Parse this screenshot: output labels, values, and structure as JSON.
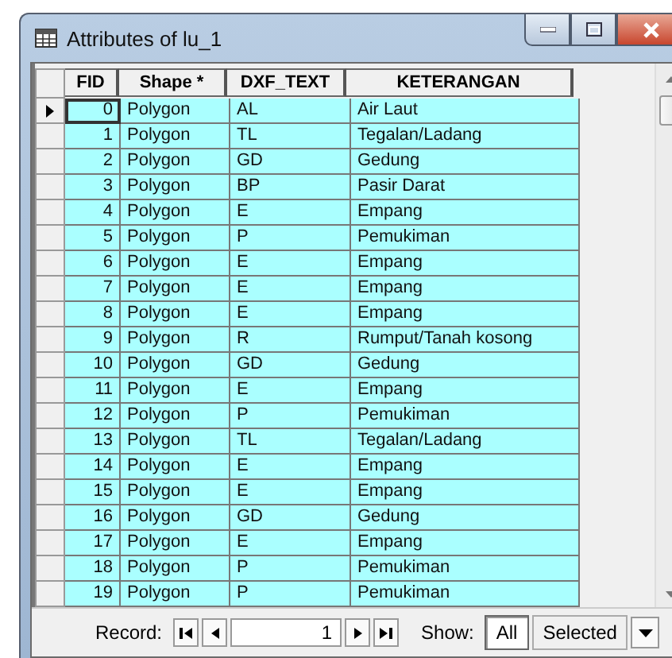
{
  "window": {
    "title": "Attributes of lu_1"
  },
  "table": {
    "columns": [
      "FID",
      "Shape *",
      "DXF_TEXT",
      "KETERANGAN"
    ],
    "rows": [
      {
        "cells": [
          "0",
          "Polygon",
          "AL",
          "Air Laut"
        ],
        "selected": true
      },
      {
        "cells": [
          "1",
          "Polygon",
          "TL",
          "Tegalan/Ladang"
        ],
        "selected": false
      },
      {
        "cells": [
          "2",
          "Polygon",
          "GD",
          "Gedung"
        ],
        "selected": false
      },
      {
        "cells": [
          "3",
          "Polygon",
          "BP",
          "Pasir Darat"
        ],
        "selected": false
      },
      {
        "cells": [
          "4",
          "Polygon",
          "E",
          "Empang"
        ],
        "selected": false
      },
      {
        "cells": [
          "5",
          "Polygon",
          "P",
          "Pemukiman"
        ],
        "selected": false
      },
      {
        "cells": [
          "6",
          "Polygon",
          "E",
          "Empang"
        ],
        "selected": false
      },
      {
        "cells": [
          "7",
          "Polygon",
          "E",
          "Empang"
        ],
        "selected": false
      },
      {
        "cells": [
          "8",
          "Polygon",
          "E",
          "Empang"
        ],
        "selected": false
      },
      {
        "cells": [
          "9",
          "Polygon",
          "R",
          "Rumput/Tanah kosong"
        ],
        "selected": false
      },
      {
        "cells": [
          "10",
          "Polygon",
          "GD",
          "Gedung"
        ],
        "selected": false
      },
      {
        "cells": [
          "11",
          "Polygon",
          "E",
          "Empang"
        ],
        "selected": false
      },
      {
        "cells": [
          "12",
          "Polygon",
          "P",
          "Pemukiman"
        ],
        "selected": false
      },
      {
        "cells": [
          "13",
          "Polygon",
          "TL",
          "Tegalan/Ladang"
        ],
        "selected": false
      },
      {
        "cells": [
          "14",
          "Polygon",
          "E",
          "Empang"
        ],
        "selected": false
      },
      {
        "cells": [
          "15",
          "Polygon",
          "E",
          "Empang"
        ],
        "selected": false
      },
      {
        "cells": [
          "16",
          "Polygon",
          "GD",
          "Gedung"
        ],
        "selected": false
      },
      {
        "cells": [
          "17",
          "Polygon",
          "E",
          "Empang"
        ],
        "selected": false
      },
      {
        "cells": [
          "18",
          "Polygon",
          "P",
          "Pemukiman"
        ],
        "selected": false
      },
      {
        "cells": [
          "19",
          "Polygon",
          "P",
          "Pemukiman"
        ],
        "selected": false
      }
    ]
  },
  "footer": {
    "record_label": "Record:",
    "record_value": "1",
    "show_label": "Show:",
    "show_options": [
      {
        "label": "All",
        "selected": true
      },
      {
        "label": "Selected",
        "selected": false
      }
    ]
  }
}
